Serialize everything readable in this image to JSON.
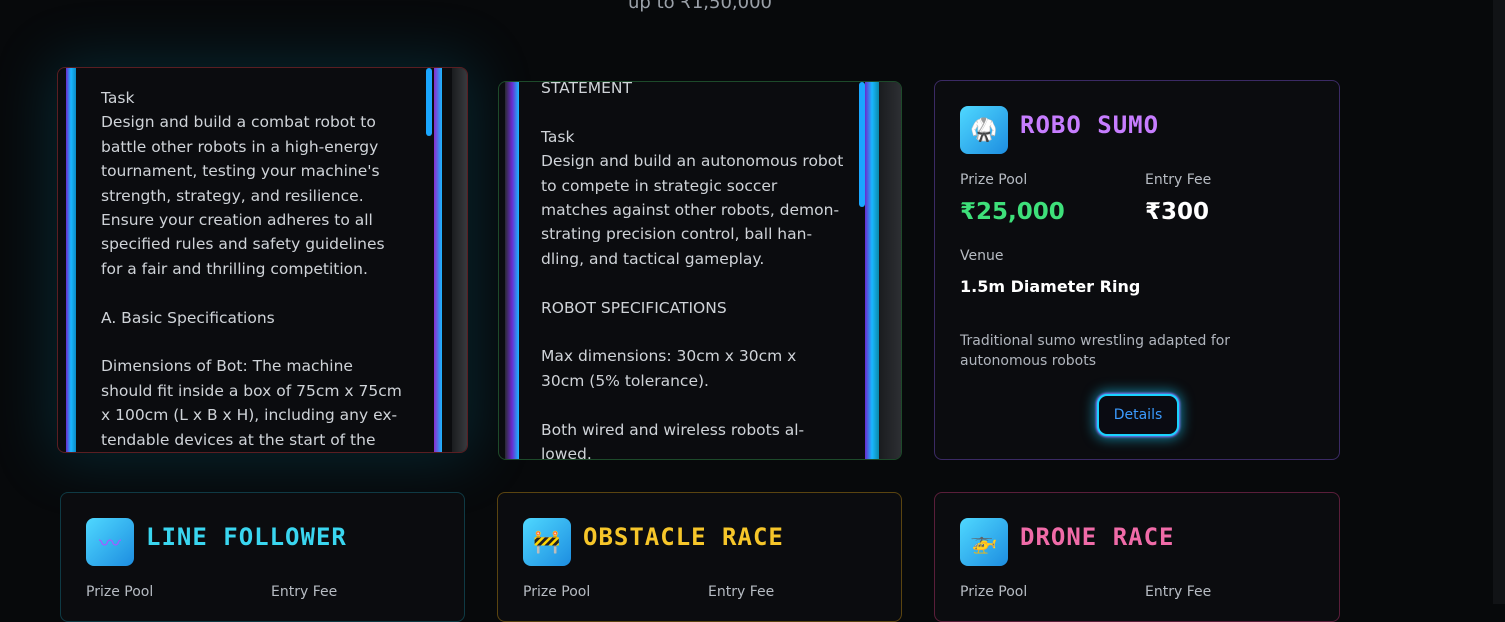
{
  "page": {
    "subheading": "up to ₹1,50,000"
  },
  "card_left_back": {
    "text": "Task\nDesign and build a combat robot to\nbattle other robots in a high-energy\ntournament, testing your machine's\nstrength, strategy, and resilience.\nEnsure your creation adheres to all\nspecified rules and safety guidelines\nfor a fair and thrilling competition.\n\nA. Basic Specifications\n\nDimensions of Bot: The machine\nshould fit inside a box of 75cm x 75cm\nx 100cm (L x B x H), including any ex-\ntendable devices at the start of the"
  },
  "card_mid_back": {
    "text": "STATEMENT\n\nTask\nDesign and build an autonomous robot\nto compete in strategic soccer\nmatches against other robots, demon-\nstrating precision control, ball han-\ndling, and tactical gameplay.\n\nROBOT SPECIFICATIONS\n\nMax dimensions: 30cm x 30cm x\n30cm (5% tolerance).\n\nBoth wired and wireless robots al-\nlowed."
  },
  "robo_sumo": {
    "title": "ROBO SUMO",
    "icon": "sumo-icon",
    "prize_label": "Prize Pool",
    "prize": "₹25,000",
    "fee_label": "Entry Fee",
    "fee": "₹300",
    "venue_label": "Venue",
    "venue": "1.5m Diameter Ring",
    "description": "Traditional sumo wrestling adapted for autonomous robots",
    "button": "Details",
    "title_color": "#c77dff"
  },
  "line_follower": {
    "title": "LINE FOLLOWER",
    "icon": "wave-icon",
    "prize_label": "Prize Pool",
    "fee_label": "Entry Fee",
    "title_color": "#3ad6f0"
  },
  "obstacle_race": {
    "title": "OBSTACLE RACE",
    "icon": "barrier-icon",
    "prize_label": "Prize Pool",
    "fee_label": "Entry Fee",
    "title_color": "#f6c62a"
  },
  "drone_race": {
    "title": "DRONE RACE",
    "icon": "drone-icon",
    "prize_label": "Prize Pool",
    "fee_label": "Entry Fee",
    "title_color": "#f06ba8"
  }
}
